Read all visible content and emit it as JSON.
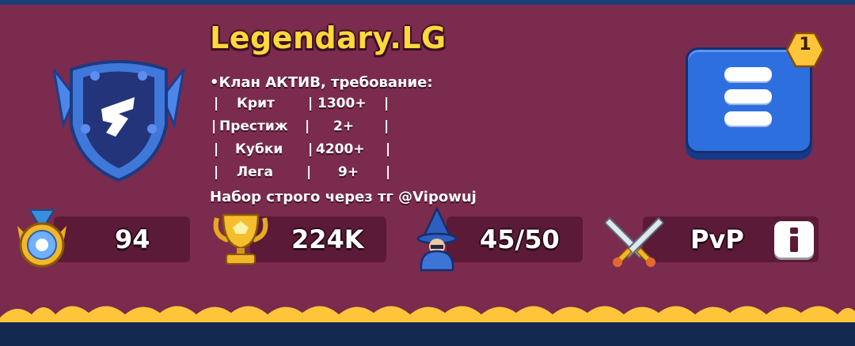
{
  "clan": {
    "name": "Legendary.LG",
    "description": {
      "headline": "•Клан АКТИВ, требование:",
      "requirements": [
        {
          "label": "Крит",
          "value": "1300+"
        },
        {
          "label": "Престиж",
          "value": "2+"
        },
        {
          "label": "Кубки",
          "value": "4200+"
        },
        {
          "label": "Лега",
          "value": "9+"
        }
      ],
      "footer": "Набор строго через тг @Vipowuj"
    }
  },
  "menu": {
    "notification_count": "1"
  },
  "stats": {
    "level": "94",
    "trophies": "224K",
    "members": "45/50",
    "mode": "PvP"
  },
  "colors": {
    "panel": "#7b2b4d",
    "pill": "#5b1a37",
    "name": "#ffd83a",
    "menu_button": "#2e6fe0",
    "zigzag": "#ffc53a"
  },
  "icons": [
    "clan-shield-icon",
    "menu-icon",
    "medal-icon",
    "trophy-icon",
    "wizard-icon",
    "crossed-swords-icon",
    "info-icon"
  ]
}
